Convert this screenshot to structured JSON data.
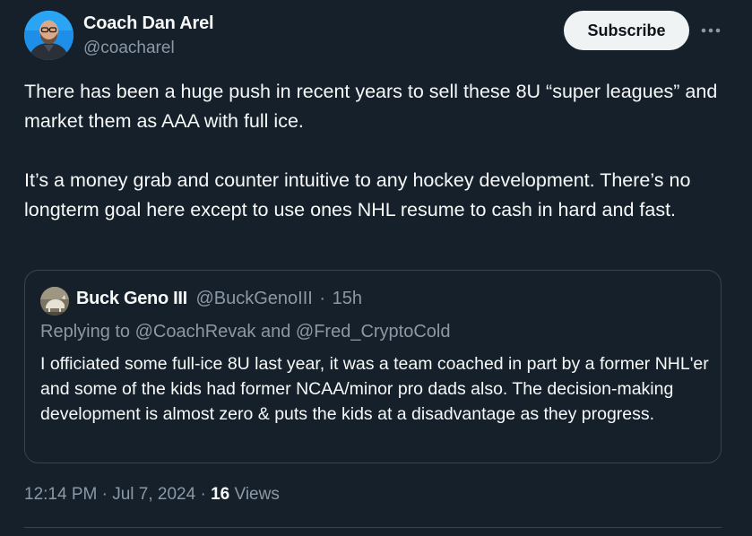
{
  "author": {
    "display_name": "Coach Dan Arel",
    "handle": "@coacharel"
  },
  "actions": {
    "subscribe_label": "Subscribe",
    "more_icon": "more-horizontal-icon"
  },
  "tweet": {
    "paragraphs": [
      "There has been a huge push in recent years to sell these 8U “super leagues” and market them as AAA with full ice.",
      "It’s a money grab and counter intuitive to any hockey development. There’s no longterm goal here except to use ones NHL resume to cash in hard and fast."
    ],
    "time": "12:14 PM",
    "separator": "·",
    "date": "Jul 7, 2024",
    "views_count": "16",
    "views_label": "Views"
  },
  "quote": {
    "display_name": "Buck Geno III",
    "handle": "@BuckGenoIII",
    "separator": "·",
    "age": "15h",
    "replying_to": "Replying to @CoachRevak and @Fred_CryptoCold",
    "text": "I officiated some full-ice 8U last year, it was a team coached in part by a former NHL'er and some of the kids had former NCAA/minor pro dads also. The decision-making development is almost zero & puts the kids at a disadvantage as they progress."
  },
  "colors": {
    "background": "#15202b",
    "text_primary": "#f7f9f9",
    "text_secondary": "#8b98a5",
    "border": "#38444d",
    "button_bg": "#eff3f4"
  }
}
